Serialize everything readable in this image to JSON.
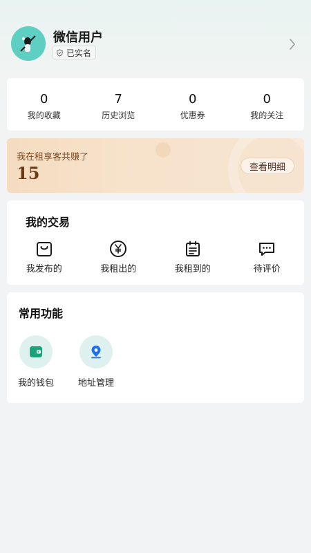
{
  "profile": {
    "username": "微信用户",
    "verify_label": "已实名"
  },
  "stats": [
    {
      "count": "0",
      "label": "我的收藏"
    },
    {
      "count": "7",
      "label": "历史浏览"
    },
    {
      "count": "0",
      "label": "优惠券"
    },
    {
      "count": "0",
      "label": "我的关注"
    }
  ],
  "earnings": {
    "title": "我在租享客共赚了",
    "amount": "15",
    "button_label": "查看明细"
  },
  "trade": {
    "title": "我的交易",
    "items": [
      {
        "label": "我发布的",
        "icon": "shopping-bag-icon"
      },
      {
        "label": "我租出的",
        "icon": "yen-coin-icon"
      },
      {
        "label": "我租到的",
        "icon": "calendar-icon"
      },
      {
        "label": "待评价",
        "icon": "comment-icon"
      }
    ]
  },
  "features": {
    "title": "常用功能",
    "items": [
      {
        "label": "我的钱包",
        "icon": "wallet-icon"
      },
      {
        "label": "地址管理",
        "icon": "location-pin-icon"
      }
    ]
  },
  "colors": {
    "accent_teal": "#5ecfc2",
    "icon_green": "#19a37a",
    "icon_blue": "#1e6ff0",
    "earnings_text": "#6b3d17"
  }
}
